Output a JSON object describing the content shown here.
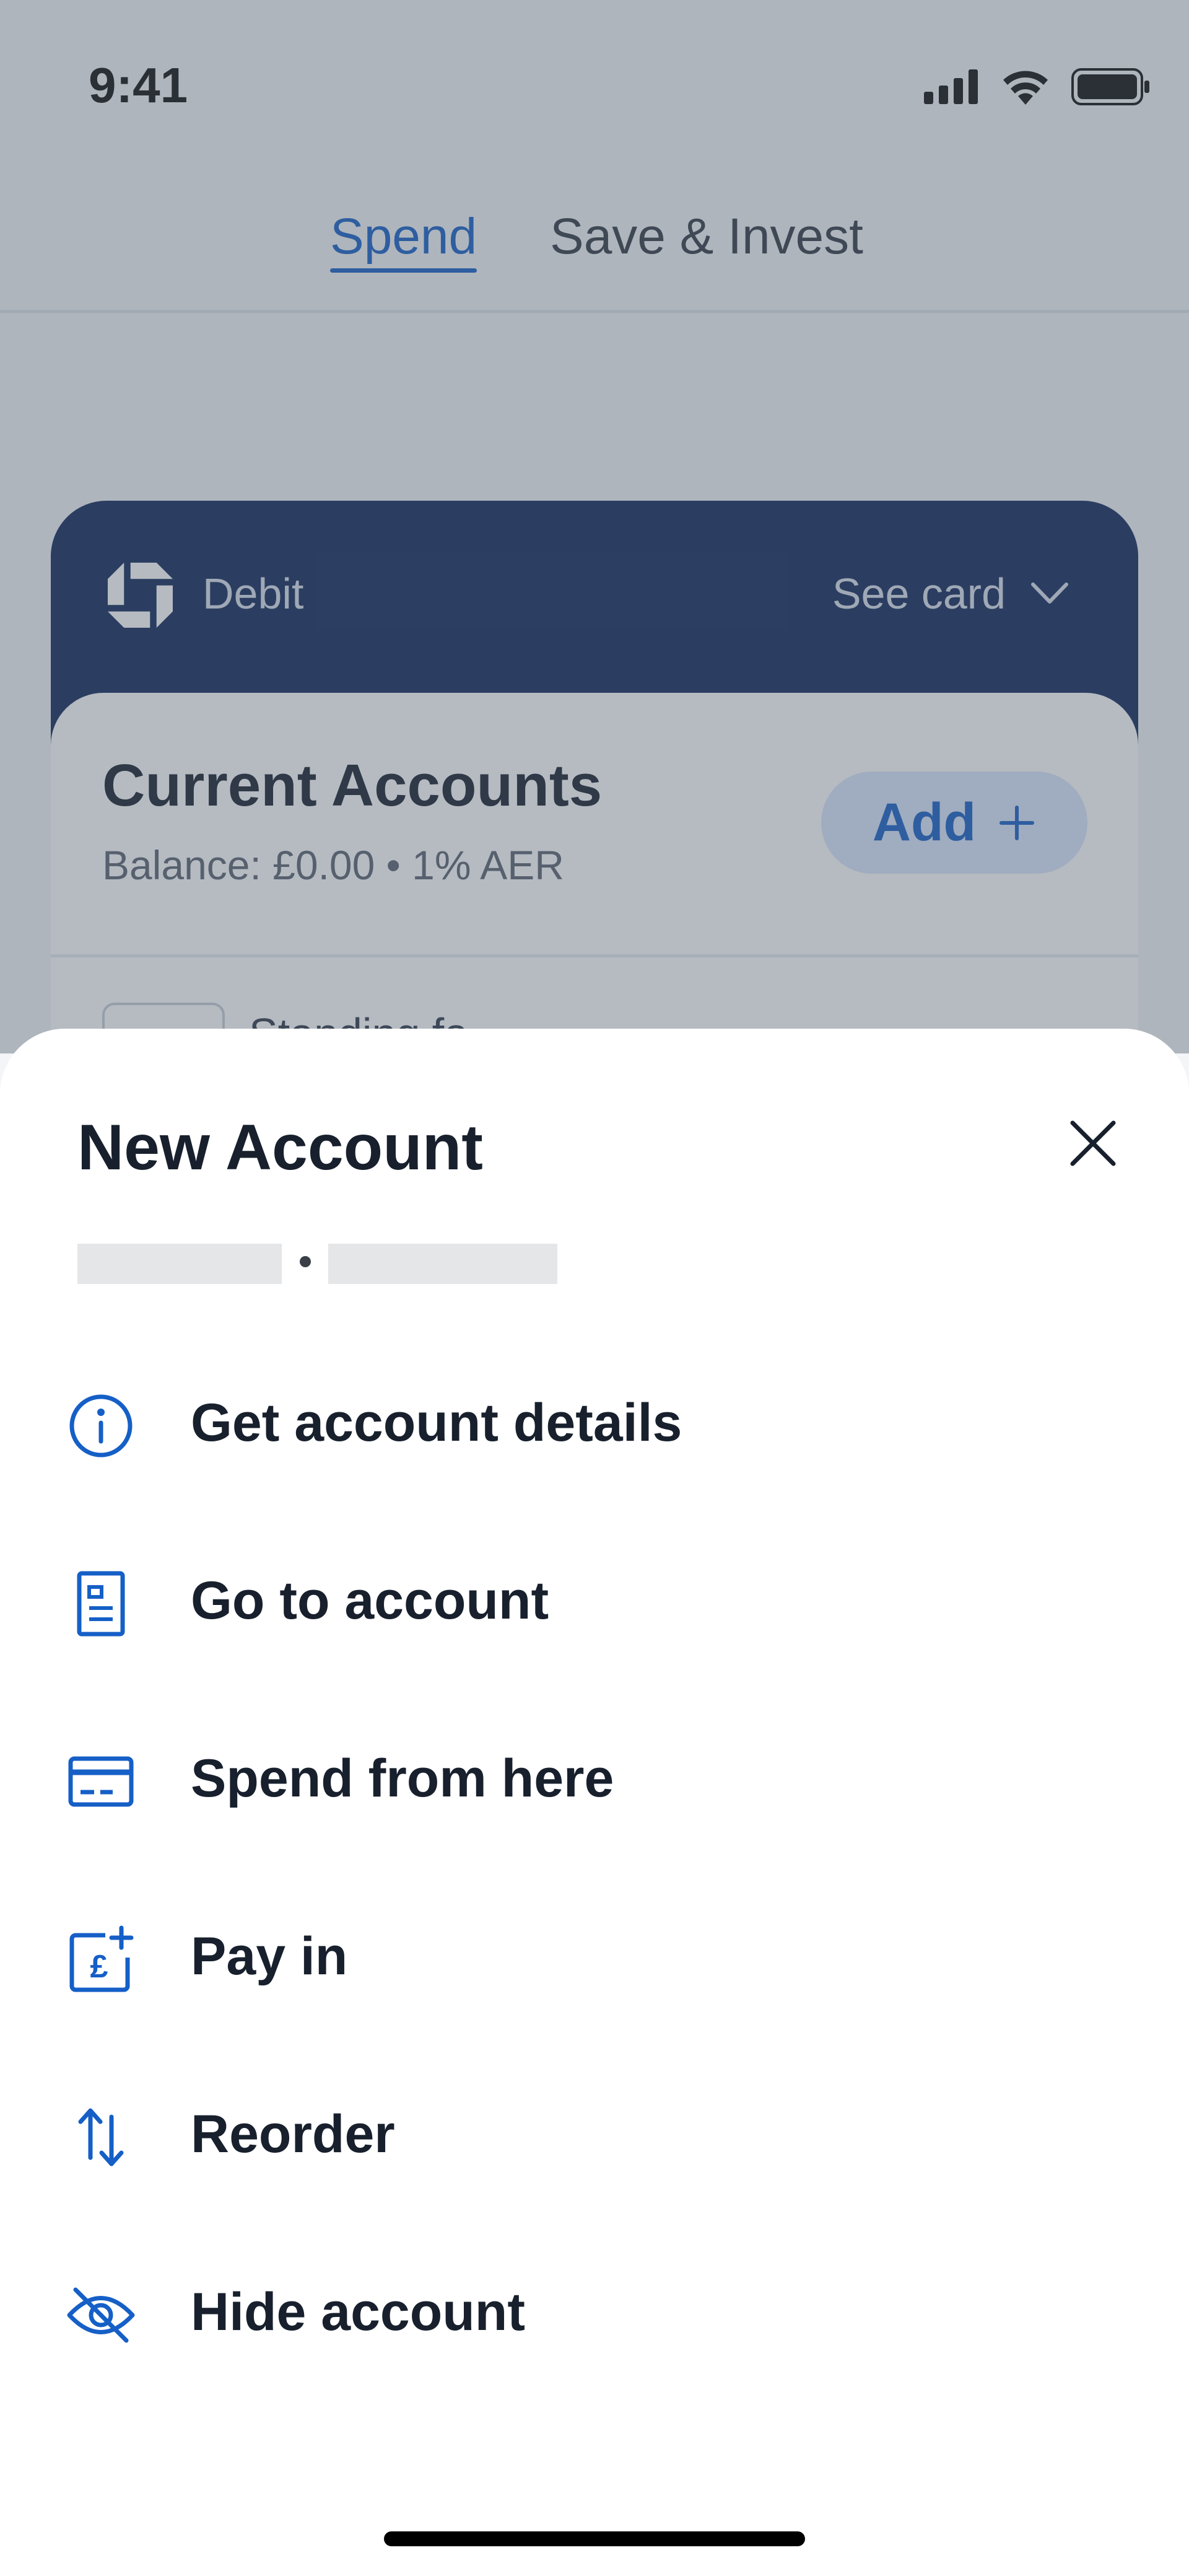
{
  "status": {
    "time": "9:41"
  },
  "tabs": [
    {
      "label": "Spend",
      "active": true
    },
    {
      "label": "Save & Invest",
      "active": false
    }
  ],
  "card": {
    "type_label": "Debit",
    "see_card_label": "See card",
    "brand_color": "#11285b"
  },
  "account_summary": {
    "title": "Current Accounts",
    "balance_text": "Balance: £0.00 • 1% AER",
    "add_label": "Add",
    "add_icon": "plus-icon",
    "peek_text": "Standing fa..."
  },
  "sheet": {
    "title": "New Account",
    "close_icon": "close-icon",
    "menu": [
      {
        "label": "Get account details",
        "icon": "info-icon"
      },
      {
        "label": "Go to account",
        "icon": "document-icon"
      },
      {
        "label": "Spend from here",
        "icon": "card-icon"
      },
      {
        "label": "Pay in",
        "icon": "pound-add-icon"
      },
      {
        "label": "Reorder",
        "icon": "reorder-icon"
      },
      {
        "label": "Hide account",
        "icon": "eye-off-icon"
      }
    ]
  },
  "colors": {
    "accent": "#155fc7",
    "text_primary": "#18202d"
  }
}
